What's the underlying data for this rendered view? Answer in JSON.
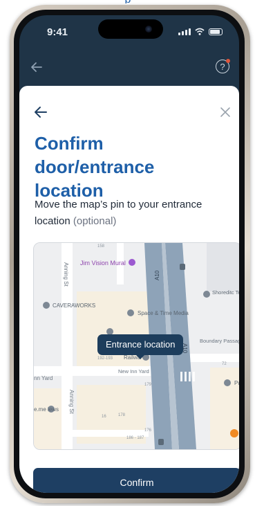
{
  "status_bar": {
    "time": "9:41"
  },
  "sheet": {
    "title": "Confirm door/entrance location",
    "subtitle_main": "Move the map’s pin to your entrance location",
    "subtitle_optional": "(optional)"
  },
  "map": {
    "tooltip": "Entrance location",
    "labels": {
      "poi_mural": "Jim Vision Mural",
      "poi_caveraworks": "CAVERAWORKS",
      "poi_space_time": "Space & Time Media",
      "poi_shoreditch": "Shoreditc Telephone",
      "street_anning_1": "Anning St",
      "street_anning_2": "Anning St",
      "road_a10_1": "A10",
      "road_a10_2": "A10",
      "street_boundary": "Boundary Passag",
      "street_new_inn_yard": "New Inn Yard",
      "street_inn_yard_left": "nn Yard",
      "poi_railway": "Railwa",
      "poi_ullme": "e.me iews",
      "poi_pu": "Pu",
      "addr_158": "158",
      "addr_192": "192-193",
      "addr_179": "179",
      "addr_16": "16",
      "addr_178": "178",
      "addr_176": "176",
      "addr_186": "186 - 187",
      "addr_72": "72"
    }
  },
  "buttons": {
    "confirm": "Confirm"
  },
  "colors": {
    "title": "#1e5fa8",
    "header_bg": "#1f3447",
    "button_bg": "#1e3f63",
    "tooltip_bg": "#1d3d5c",
    "road_major": "#8aa0b5",
    "map_bg": "#eeeff1"
  }
}
